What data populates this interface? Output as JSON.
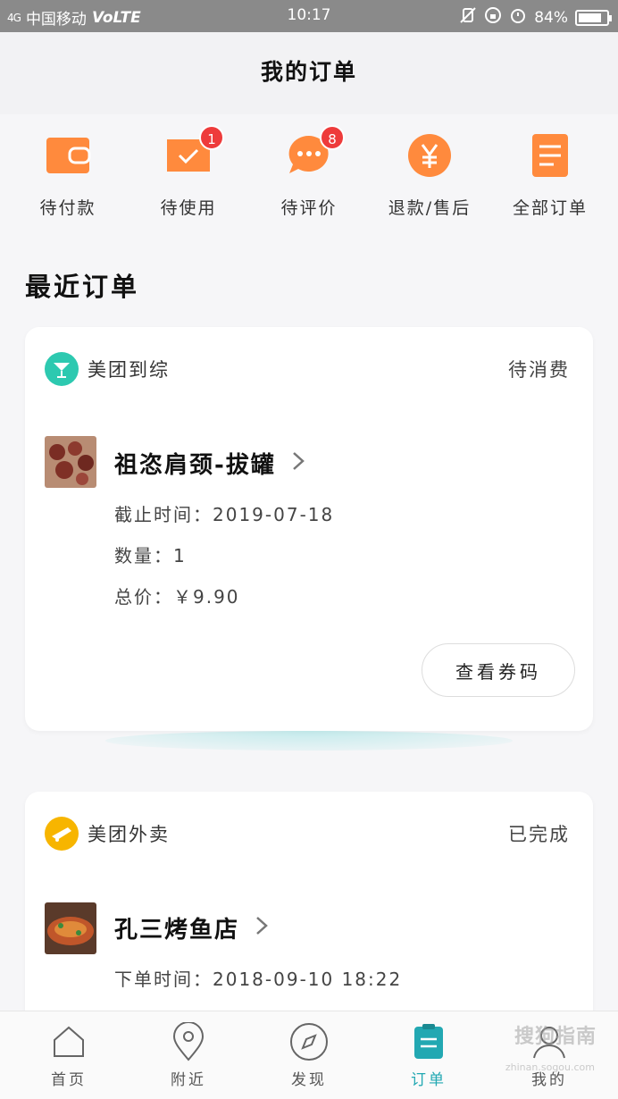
{
  "status_bar": {
    "signal": "4G",
    "carrier": "中国移动",
    "network": "VoLTE",
    "time": "10:17",
    "battery": "84%",
    "battery_level": 0.84
  },
  "header": {
    "title": "我的订单"
  },
  "quick_entries": [
    {
      "label": "待付款",
      "icon": "wallet-icon",
      "badge": ""
    },
    {
      "label": "待使用",
      "icon": "ticket-check-icon",
      "badge": "1"
    },
    {
      "label": "待评价",
      "icon": "comment-icon",
      "badge": "8"
    },
    {
      "label": "退款/售后",
      "icon": "yen-icon",
      "badge": ""
    },
    {
      "label": "全部订单",
      "icon": "list-doc-icon",
      "badge": ""
    }
  ],
  "section_title": "最近订单",
  "orders": [
    {
      "brand": "美团到综",
      "brand_icon": "cocktail-icon",
      "brand_color": "#2dc9b0",
      "status": "待消费",
      "shop": "祖恣肩颈-拔罐",
      "lines": [
        "截止时间：2019-07-18",
        "数量：1",
        "总价：￥9.90"
      ],
      "action": "查看券码"
    },
    {
      "brand": "美团外卖",
      "brand_icon": "delivery-icon",
      "brand_color": "#f7b500",
      "status": "已完成",
      "shop": "孔三烤鱼店",
      "lines": [
        "下单时间：2018-09-10 18:22"
      ]
    }
  ],
  "tabbar": {
    "tabs": [
      {
        "label": "首页",
        "icon": "home-icon"
      },
      {
        "label": "附近",
        "icon": "location-pin-icon"
      },
      {
        "label": "发现",
        "icon": "compass-icon"
      },
      {
        "label": "订单",
        "icon": "order-doc-icon",
        "active": true
      },
      {
        "label": "我的",
        "icon": "user-icon"
      }
    ]
  },
  "watermark": {
    "text": "搜狗指南",
    "sub": "zhinan.sogou.com"
  },
  "colors": {
    "accent_orange": "#ff8a3d",
    "active_teal": "#22a8b2",
    "badge_red": "#ee3b3b"
  }
}
